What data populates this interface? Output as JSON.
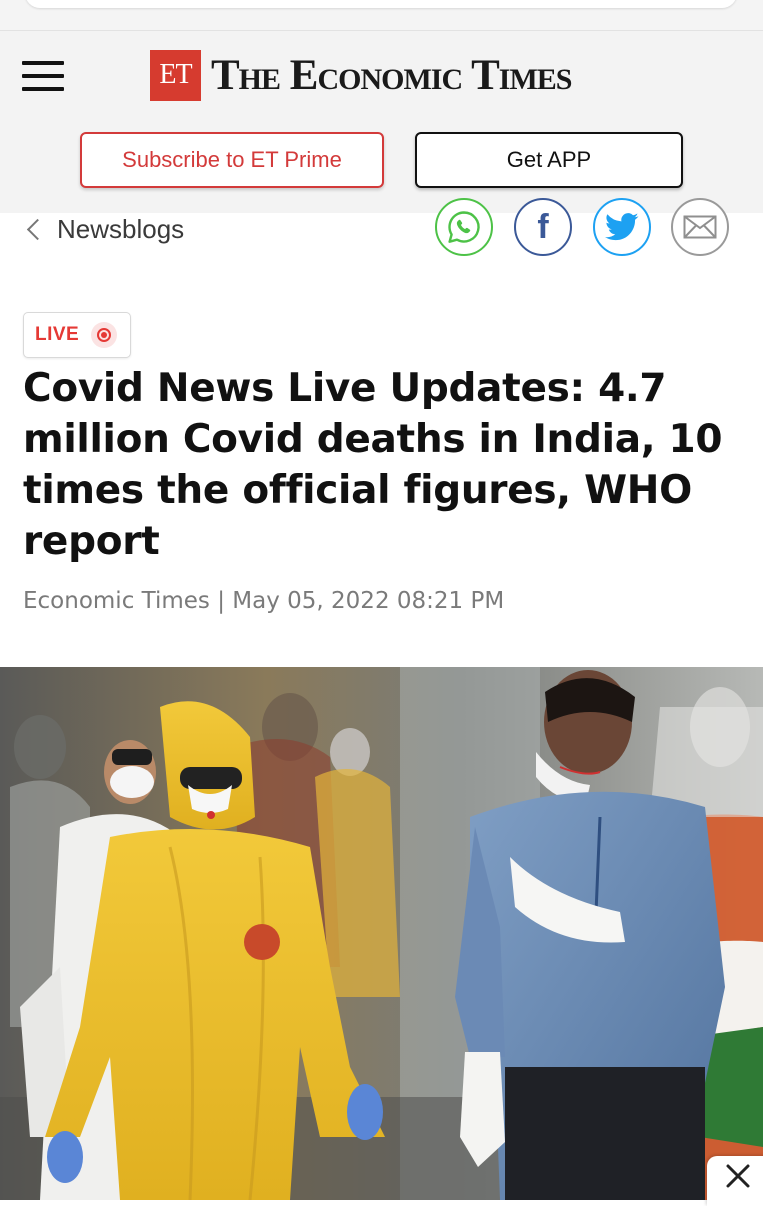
{
  "brand": {
    "logo_mark": "ET",
    "name": "The Economic Times"
  },
  "header": {
    "menu_icon": "hamburger-icon",
    "subscribe_label": "Subscribe to ET Prime",
    "app_label": "Get APP"
  },
  "breadcrumb": {
    "back_icon": "chevron-left-icon",
    "label": "Newsblogs"
  },
  "share": {
    "icons": [
      "whatsapp-icon",
      "facebook-icon",
      "twitter-icon",
      "email-icon"
    ],
    "facebook_glyph": "f"
  },
  "article": {
    "badge": "LIVE",
    "headline": "Covid News Live Updates: 4.7 million Covid deaths in India, 10 times the official figures, WHO report",
    "byline": "Economic Times | May 05, 2022 08:21 PM",
    "image_icon": "news-photo"
  },
  "overlay": {
    "close_icon": "close-icon"
  },
  "colors": {
    "brand_red": "#d63b2f",
    "subscribe_red": "#d33a3a",
    "live_red": "#e53935",
    "whatsapp_green": "#4dc247",
    "facebook_blue": "#3b5998",
    "twitter_blue": "#1da1f2"
  }
}
